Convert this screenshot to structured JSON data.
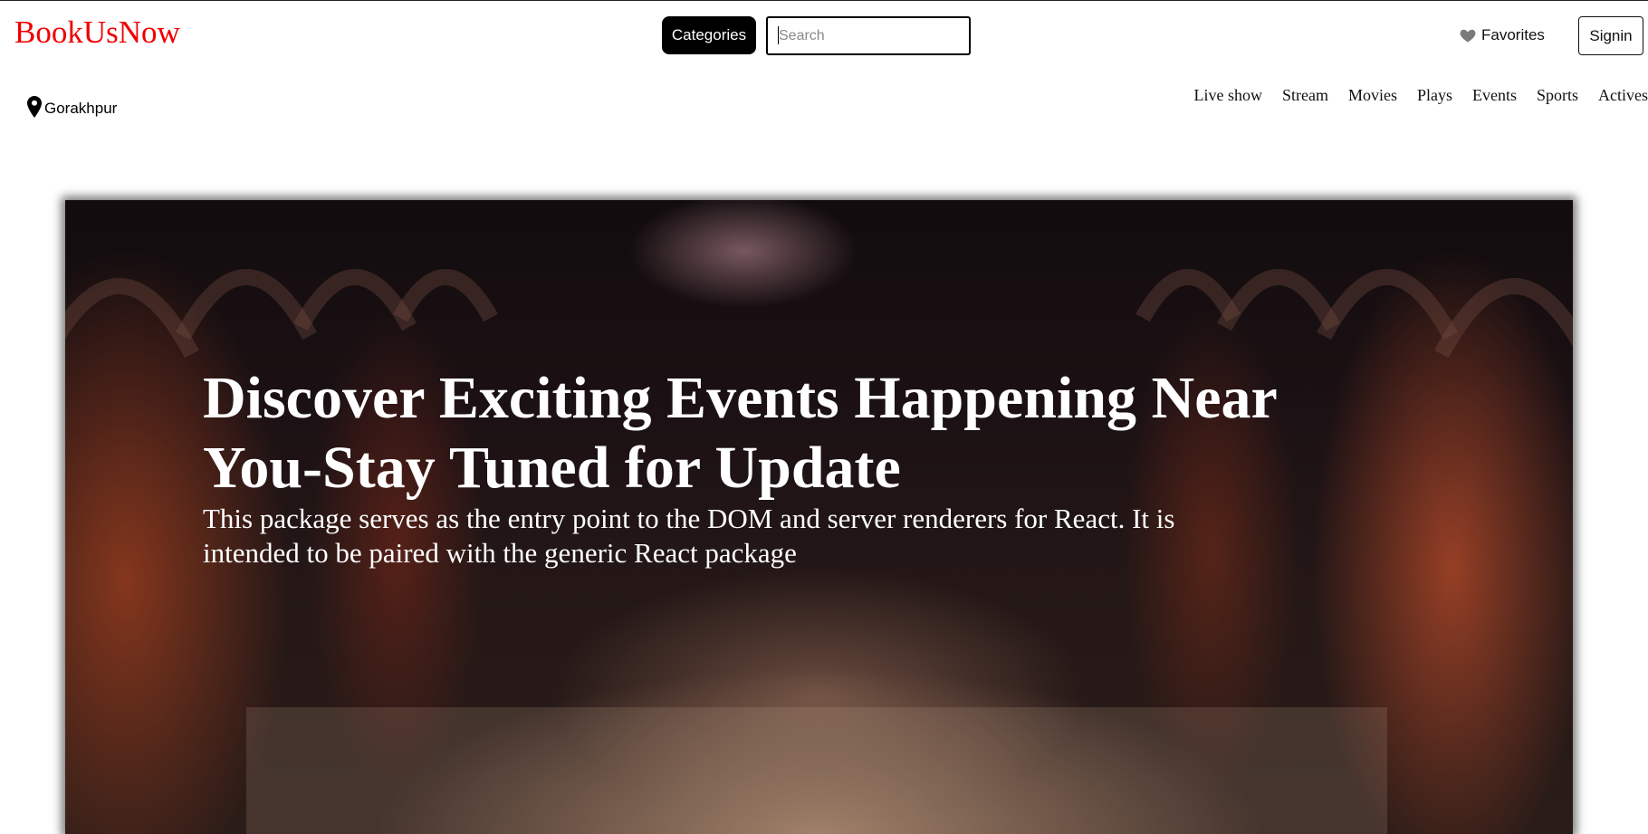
{
  "header": {
    "logo": "BookUsNow",
    "categories_label": "Categories",
    "search": {
      "placeholder": "Search",
      "value": ""
    },
    "favorites_label": "Favorites",
    "signin_label": "Signin",
    "icons": {
      "favorites": "heart-icon",
      "location": "map-pin-icon"
    }
  },
  "location": {
    "city": "Gorakhpur"
  },
  "nav": {
    "items": [
      {
        "label": "Live show"
      },
      {
        "label": "Stream"
      },
      {
        "label": "Movies"
      },
      {
        "label": "Plays"
      },
      {
        "label": "Events"
      },
      {
        "label": "Sports"
      },
      {
        "label": "Actives"
      }
    ]
  },
  "hero": {
    "title": "Discover Exciting Events Happening Near You-Stay Tuned for Update",
    "subtitle": "This package serves as the entry point to the DOM and server renderers for React. It is intended to be paired with the generic React package"
  },
  "colors": {
    "logo": "#f00000",
    "categories_bg": "#000000",
    "hero_text": "#ffffff"
  }
}
